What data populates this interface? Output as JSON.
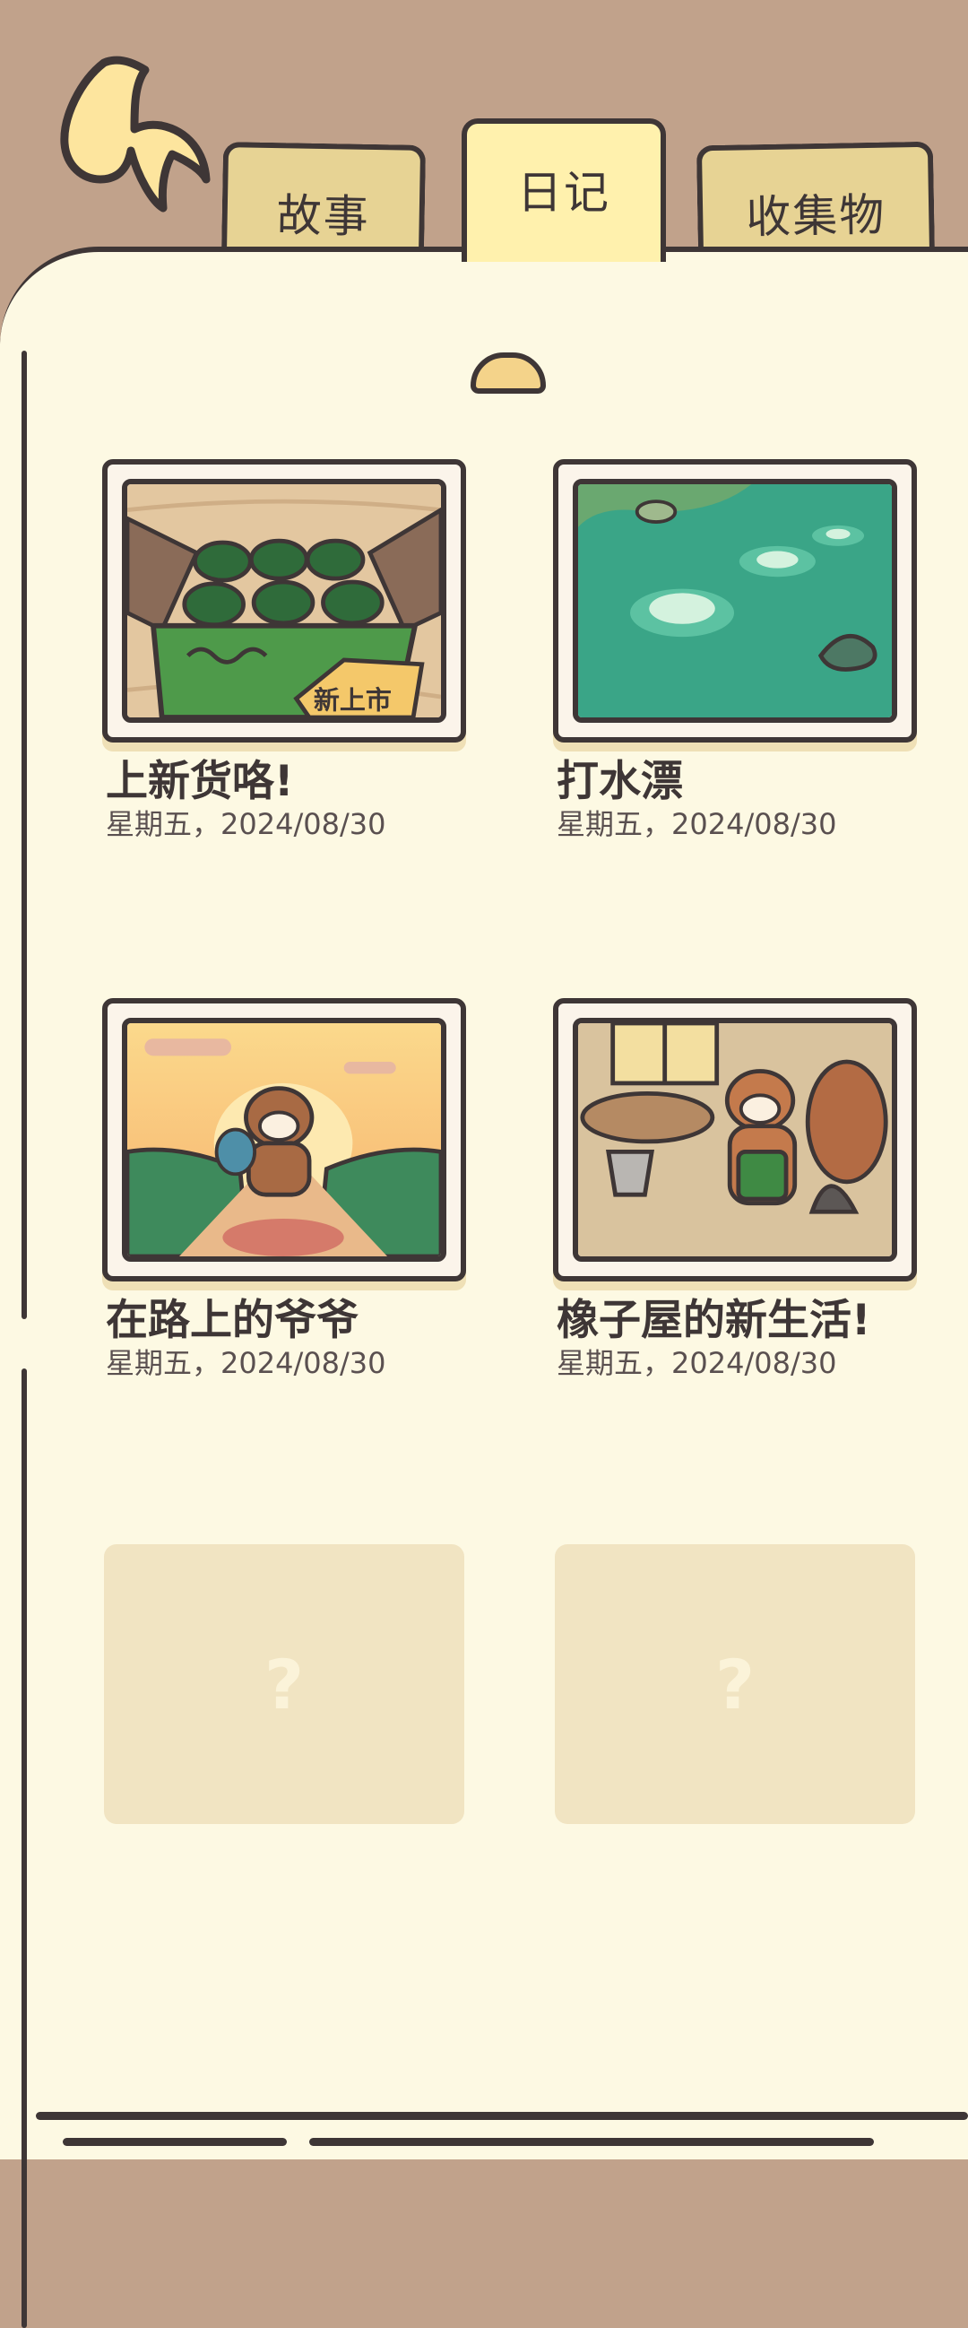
{
  "tabs": [
    {
      "label": "故事",
      "selected": false
    },
    {
      "label": "日记",
      "selected": true
    },
    {
      "label": "收集物",
      "selected": false
    }
  ],
  "entries": [
    {
      "title": "上新货咯!",
      "date": "星期五，2024/08/30",
      "image_icon": "soda-cans-box-picture",
      "stamp": "新上市"
    },
    {
      "title": "打水漂",
      "date": "星期五，2024/08/30",
      "image_icon": "pond-ripples-picture"
    },
    {
      "title": "在路上的爷爷",
      "date": "星期五，2024/08/30",
      "image_icon": "grandpa-on-road-picture"
    },
    {
      "title": "橡子屋的新生活!",
      "date": "星期五，2024/08/30",
      "image_icon": "squirrel-cleaning-picture"
    }
  ],
  "locked_entries": [
    {
      "symbol": "?"
    },
    {
      "symbol": "?"
    }
  ],
  "colors": {
    "background": "#c1a28b",
    "page": "#fdf9e3",
    "tab": "#e7d394",
    "tab_selected": "#fff1ad",
    "outline": "#3e3636",
    "locked": "#f1e4c2"
  }
}
